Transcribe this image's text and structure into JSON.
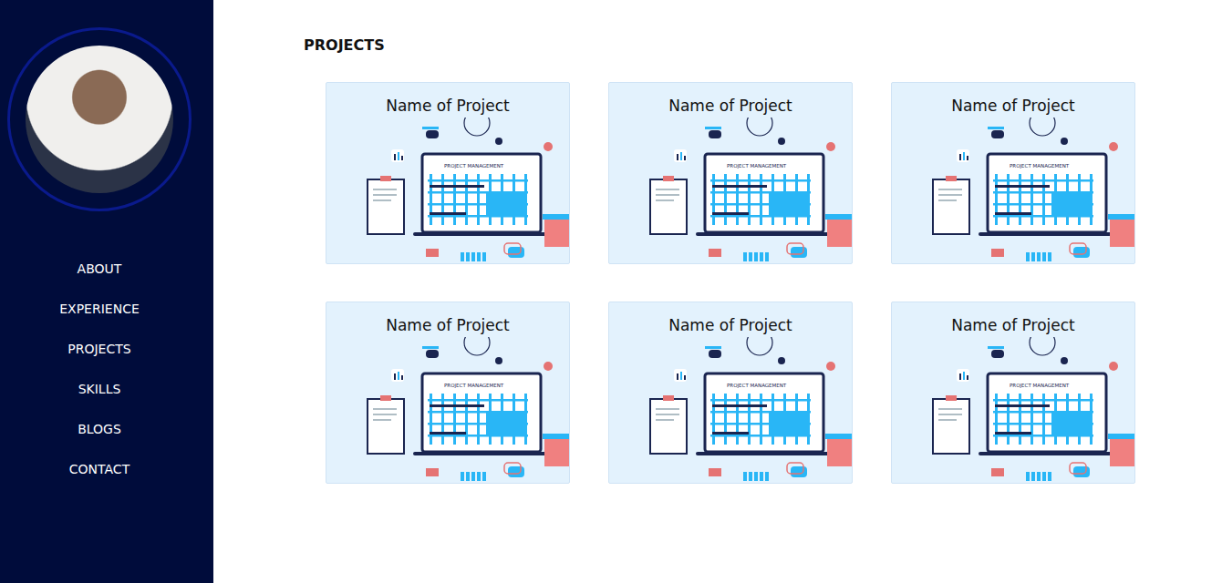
{
  "sidebar": {
    "avatar": {
      "alt": "profile photo"
    },
    "items": [
      {
        "label": "ABOUT"
      },
      {
        "label": "EXPERIENCE"
      },
      {
        "label": "PROJECTS"
      },
      {
        "label": "SKILLS"
      },
      {
        "label": "BLOGS"
      },
      {
        "label": "CONTACT"
      }
    ]
  },
  "main": {
    "heading": "PROJECTS",
    "projects": [
      {
        "title": "Name of Project",
        "screen_label": "PROJECT MANAGEMENT"
      },
      {
        "title": "Name of Project",
        "screen_label": "PROJECT MANAGEMENT"
      },
      {
        "title": "Name of Project",
        "screen_label": "PROJECT MANAGEMENT"
      },
      {
        "title": "Name of Project",
        "screen_label": "PROJECT MANAGEMENT"
      },
      {
        "title": "Name of Project",
        "screen_label": "PROJECT MANAGEMENT"
      },
      {
        "title": "Name of Project",
        "screen_label": "PROJECT MANAGEMENT"
      }
    ]
  }
}
